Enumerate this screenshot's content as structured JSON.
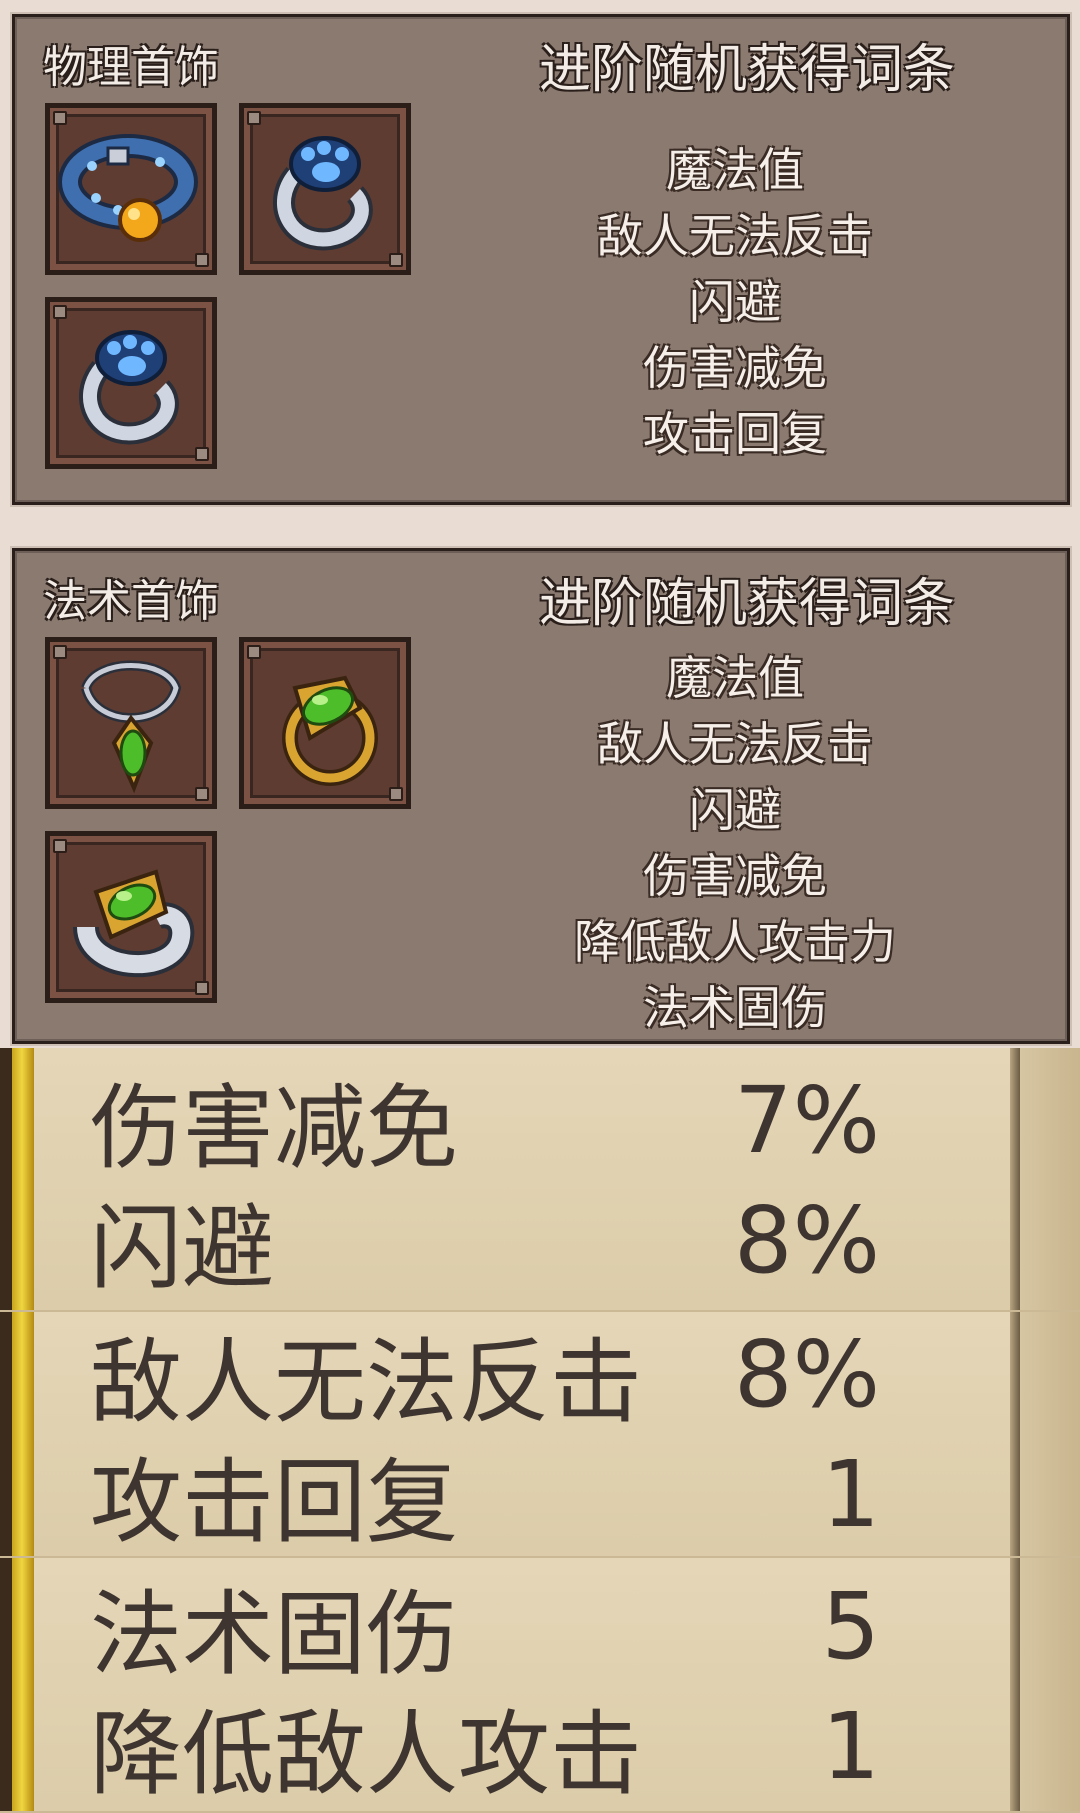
{
  "physical_panel": {
    "title": "物理首饰",
    "subtitle": "进阶随机获得词条",
    "affixes": [
      "魔法值",
      "敌人无法反击",
      "闪避",
      "伤害减免",
      "攻击回复"
    ],
    "items": [
      {
        "icon": "collar-bell-icon"
      },
      {
        "icon": "paw-ring-icon"
      },
      {
        "icon": "paw-ring-icon"
      }
    ]
  },
  "magic_panel": {
    "title": "法术首饰",
    "subtitle": "进阶随机获得词条",
    "affixes": [
      "魔法值",
      "敌人无法反击",
      "闪避",
      "伤害减免",
      "降低敌人攻击力",
      "法术固伤"
    ],
    "items": [
      {
        "icon": "fish-necklace-icon"
      },
      {
        "icon": "fish-ring-icon"
      },
      {
        "icon": "fish-ring-icon"
      }
    ]
  },
  "stats": [
    {
      "label": "伤害减免",
      "value": "7%"
    },
    {
      "label": "闪避",
      "value": "8%"
    },
    {
      "label": "敌人无法反击",
      "value": "8%"
    },
    {
      "label": "攻击回复",
      "value": "1"
    },
    {
      "label": "法术固伤",
      "value": "5"
    },
    {
      "label": "降低敌人攻击",
      "value": "1"
    }
  ],
  "colors": {
    "panel_bg": "#8a7a70",
    "stat_bg": "#e2d3b4",
    "gold_trim": "#f0d640",
    "stat_text": "#3e3530"
  }
}
